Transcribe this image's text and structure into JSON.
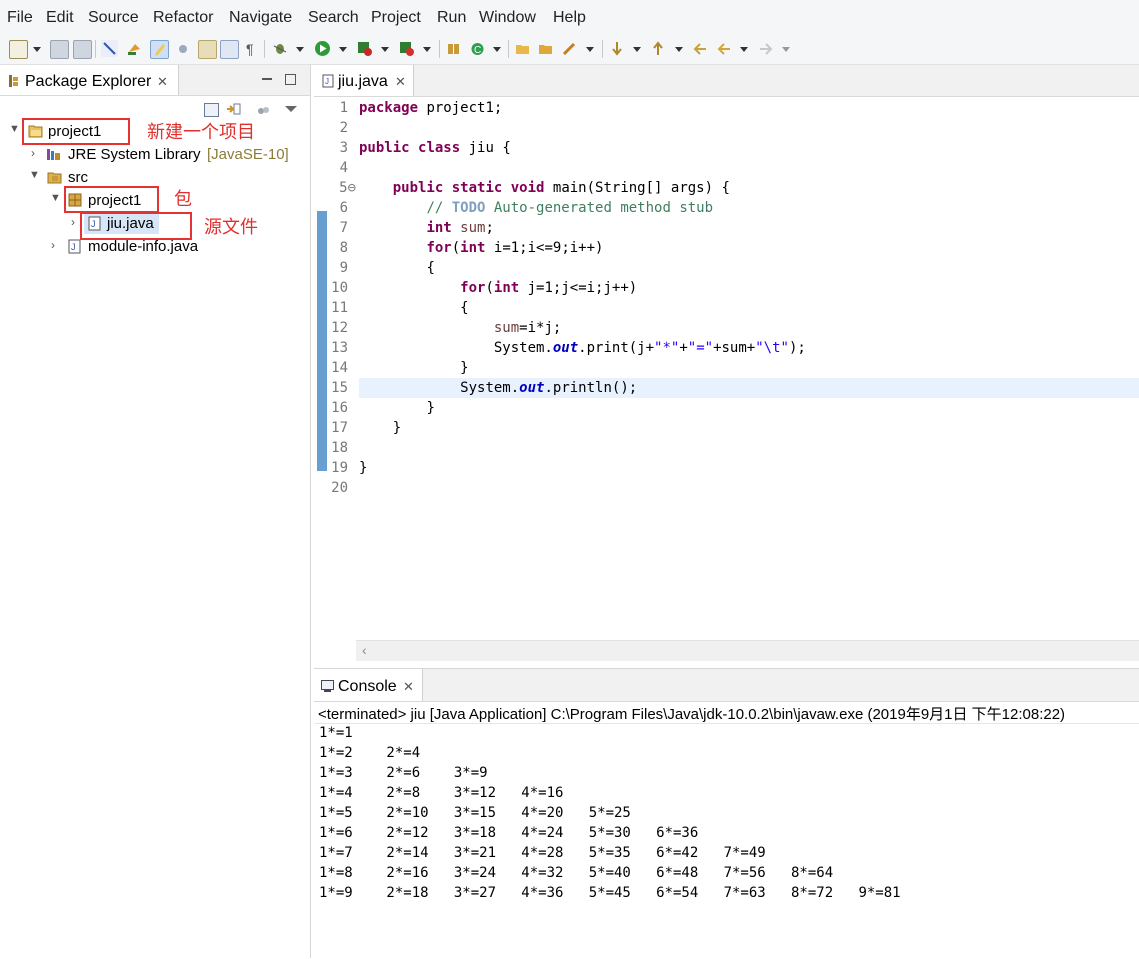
{
  "menu": [
    "File",
    "Edit",
    "Source",
    "Refactor",
    "Navigate",
    "Search",
    "Project",
    "Run",
    "Window",
    "Help"
  ],
  "package_explorer": {
    "tab_label": "Package Explorer",
    "tree": {
      "project": "project1",
      "jre_label": "JRE System Library",
      "jre_version": "[JavaSE-10]",
      "src": "src",
      "package": "project1",
      "file": "jiu.java",
      "module_info": "module-info.java"
    },
    "annotations": {
      "project": "新建一个项目",
      "package": "包",
      "source_file": "源文件"
    }
  },
  "editor": {
    "tab_label": "jiu.java",
    "line_numbers": [
      "1",
      "2",
      "3",
      "4",
      "5⊖",
      "6",
      "7",
      "8",
      "9",
      "10",
      "11",
      "12",
      "13",
      "14",
      "15",
      "16",
      "17",
      "18",
      "19",
      "20"
    ],
    "code": {
      "l1_kw": "package",
      "l1_rest": " project1;",
      "l3_kw1": "public",
      "l3_kw2": "class",
      "l3_rest": " jiu {",
      "l5_kw1": "public",
      "l5_kw2": "static",
      "l5_kw3": "void",
      "l5_rest": " main(String[] args) {",
      "l6_c1": "// ",
      "l6_todo": "TODO",
      "l6_c2": " Auto-generated method stub",
      "l7_kw": "int",
      "l7_var": " sum",
      "l7_rest": ";",
      "l8_kw1": "for",
      "l8_p1": "(",
      "l8_kw2": "int",
      "l8_rest": " i=1;i<=9;i++)",
      "l9": "{",
      "l10_kw1": "for",
      "l10_p1": "(",
      "l10_kw2": "int",
      "l10_rest": " j=1;j<=i;j++)",
      "l11": "{",
      "l12_var": "sum",
      "l12_rest": "=i*j;",
      "l13_a": "System.",
      "l13_out": "out",
      "l13_b": ".print(j+",
      "l13_s1": "\"*\"",
      "l13_c": "+",
      "l13_s2": "\"=\"",
      "l13_d": "+sum+",
      "l13_s3": "\"\\t\"",
      "l13_e": ");",
      "l14": "}",
      "l15_a": "System.",
      "l15_out": "out",
      "l15_b": ".println();",
      "l16": "}",
      "l17": "}",
      "l19": "}"
    }
  },
  "console": {
    "tab_label": "Console",
    "status": "<terminated> jiu [Java Application] C:\\Program Files\\Java\\jdk-10.0.2\\bin\\javaw.exe (2019年9月1日 下午12:08:22)",
    "output": [
      "1*=1",
      "1*=2    2*=4",
      "1*=3    2*=6    3*=9",
      "1*=4    2*=8    3*=12   4*=16",
      "1*=5    2*=10   3*=15   4*=20   5*=25",
      "1*=6    2*=12   3*=18   4*=24   5*=30   6*=36",
      "1*=7    2*=14   3*=21   4*=28   5*=35   6*=42   7*=49",
      "1*=8    2*=16   3*=24   4*=32   5*=40   6*=48   7*=56   8*=64",
      "1*=9    2*=18   3*=27   4*=36   5*=45   6*=54   7*=63   8*=72   9*=81"
    ]
  },
  "colors": {
    "keyword": "#7f0055",
    "comment": "#3f7f5f",
    "string": "#2a00ff",
    "static_field": "#0000c0",
    "annotation_red": "#e53333"
  }
}
